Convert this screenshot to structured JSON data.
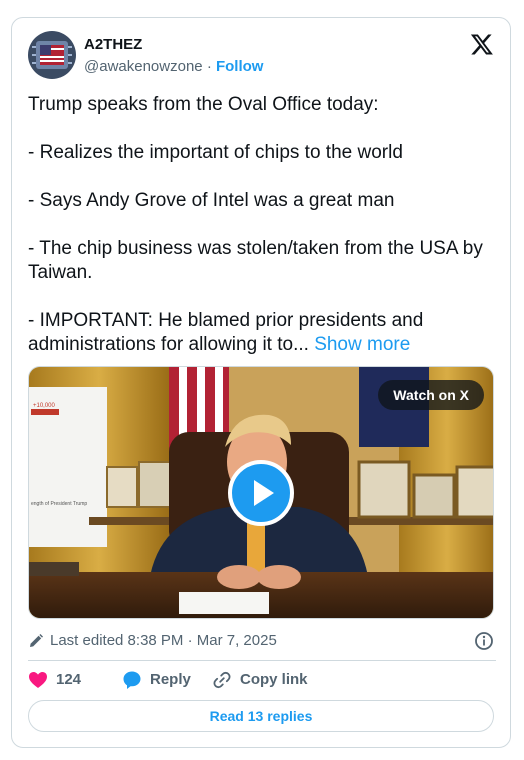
{
  "user": {
    "display_name": "A2THEZ",
    "handle": "@awakenowzone",
    "separator": "·",
    "follow_label": "Follow"
  },
  "tweet": {
    "lines": [
      "Trump speaks from the Oval Office today:",
      "- Realizes the important of chips to the world",
      "- Says Andy Grove of Intel was a great man",
      "- The chip business was stolen/taken from the USA by Taiwan.",
      "- IMPORTANT: He blamed prior presidents and administrations for allowing it to..."
    ],
    "show_more_label": "Show more"
  },
  "media": {
    "watch_label": "Watch on X",
    "chart_snippet": "+10,000",
    "chart_caption": "ength of President Trump"
  },
  "meta": {
    "edited_text": "Last edited 8:38 PM · Mar 7, 2025",
    "icon": "pencil-icon",
    "info_icon": "info-icon"
  },
  "actions": {
    "like_count": "124",
    "reply_label": "Reply",
    "copy_label": "Copy link"
  },
  "footer": {
    "read_replies_label": "Read 13 replies"
  },
  "colors": {
    "accent": "#1d9bf0",
    "like": "#f91880",
    "text": "#0f1419",
    "muted": "#536471",
    "border": "#cfd9de"
  }
}
